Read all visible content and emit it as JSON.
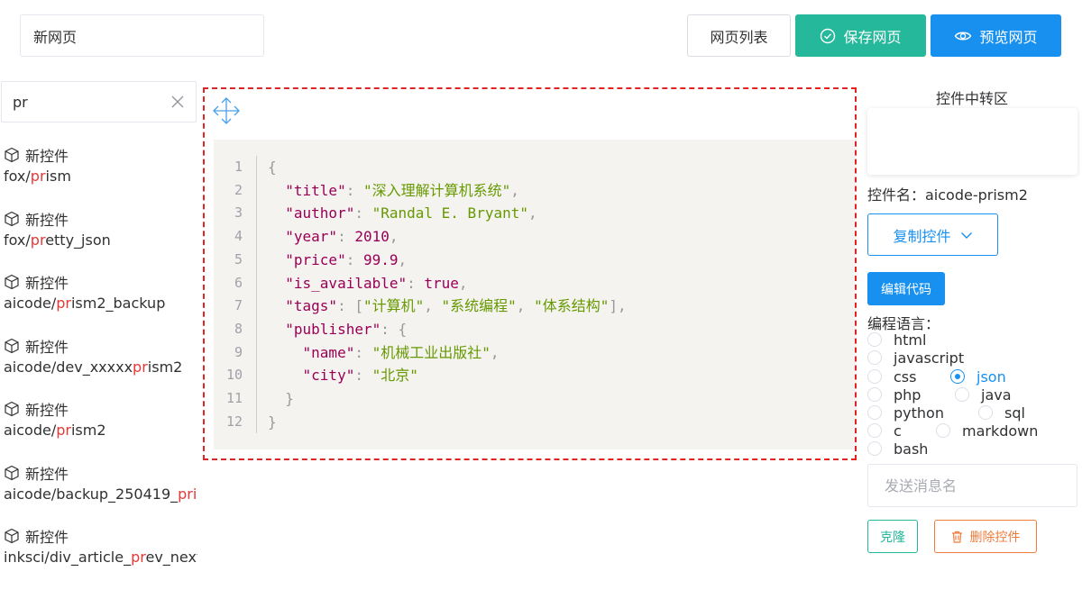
{
  "header": {
    "page_title_value": "新网页",
    "list_button": "网页列表",
    "save_button": "保存网页",
    "preview_button": "预览网页"
  },
  "search": {
    "value": "pr",
    "results": [
      {
        "title": "新控件",
        "pre": "fox/",
        "hl": "pr",
        "post": "ism"
      },
      {
        "title": "新控件",
        "pre": "fox/",
        "hl": "pr",
        "post": "etty_json"
      },
      {
        "title": "新控件",
        "pre": "aicode/",
        "hl": "pr",
        "post": "ism2_backup"
      },
      {
        "title": "新控件",
        "pre": "aicode/dev_xxxxx",
        "hl": "pr",
        "post": "ism2"
      },
      {
        "title": "新控件",
        "pre": "aicode/",
        "hl": "pr",
        "post": "ism2"
      },
      {
        "title": "新控件",
        "pre": "aicode/backup_250419_",
        "hl": "pris",
        "post": ""
      },
      {
        "title": "新控件",
        "pre": "inksci/div_article_",
        "hl": "pr",
        "post": "ev_next"
      }
    ]
  },
  "editor": {
    "line_numbers": [
      "1",
      "2",
      "3",
      "4",
      "5",
      "6",
      "7",
      "8",
      "9",
      "10",
      "11",
      "12"
    ],
    "code_lines": [
      [
        [
          "p",
          "{"
        ]
      ],
      [
        [
          "k",
          "  \"title\""
        ],
        [
          "p",
          ": "
        ],
        [
          "s",
          "\"深入理解计算机系统\""
        ],
        [
          "p",
          ","
        ]
      ],
      [
        [
          "k",
          "  \"author\""
        ],
        [
          "p",
          ": "
        ],
        [
          "s",
          "\"Randal E. Bryant\""
        ],
        [
          "p",
          ","
        ]
      ],
      [
        [
          "k",
          "  \"year\""
        ],
        [
          "p",
          ": "
        ],
        [
          "n",
          "2010"
        ],
        [
          "p",
          ","
        ]
      ],
      [
        [
          "k",
          "  \"price\""
        ],
        [
          "p",
          ": "
        ],
        [
          "n",
          "99.9"
        ],
        [
          "p",
          ","
        ]
      ],
      [
        [
          "k",
          "  \"is_available\""
        ],
        [
          "p",
          ": "
        ],
        [
          "n",
          "true"
        ],
        [
          "p",
          ","
        ]
      ],
      [
        [
          "k",
          "  \"tags\""
        ],
        [
          "p",
          ": ["
        ],
        [
          "s",
          "\"计算机\""
        ],
        [
          "p",
          ", "
        ],
        [
          "s",
          "\"系统编程\""
        ],
        [
          "p",
          ", "
        ],
        [
          "s",
          "\"体系结构\""
        ],
        [
          "p",
          "],"
        ]
      ],
      [
        [
          "k",
          "  \"publisher\""
        ],
        [
          "p",
          ": {"
        ]
      ],
      [
        [
          "k",
          "    \"name\""
        ],
        [
          "p",
          ": "
        ],
        [
          "s",
          "\"机械工业出版社\""
        ],
        [
          "p",
          ","
        ]
      ],
      [
        [
          "k",
          "    \"city\""
        ],
        [
          "p",
          ": "
        ],
        [
          "s",
          "\"北京\""
        ]
      ],
      [
        [
          "p",
          "  }"
        ]
      ],
      [
        [
          "p",
          "}"
        ]
      ]
    ]
  },
  "right_panel": {
    "relay_title": "控件中转区",
    "control_name": "控件名：aicode-prism2",
    "copy_button": "复制控件",
    "edit_button": "编辑代码",
    "lang_label": "编程语言：",
    "languages": [
      "html",
      "javascript",
      "css",
      "json",
      "php",
      "java",
      "python",
      "sql",
      "c",
      "markdown",
      "bash"
    ],
    "selected_language": "json",
    "message_placeholder": "发送消息名",
    "clone_button": "克隆",
    "delete_button": "删除控件"
  },
  "colors": {
    "green": "#26b89b",
    "blue": "#1890f0",
    "red_dashed": "#e02424",
    "orange": "#f07c3c",
    "highlight": "#e53935"
  }
}
